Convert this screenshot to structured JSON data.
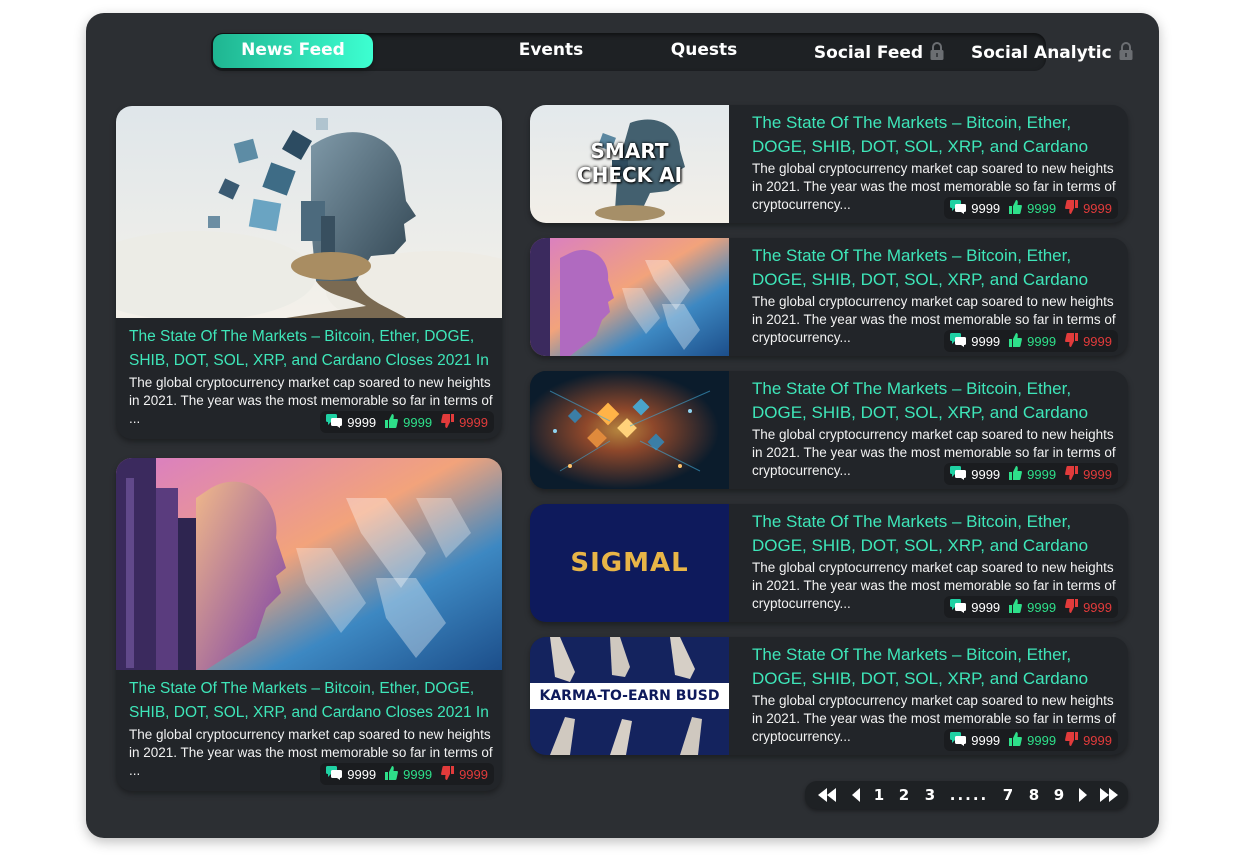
{
  "tabs": [
    {
      "label": "News Feed",
      "active": true,
      "locked": false
    },
    {
      "label": "Events",
      "active": false,
      "locked": false
    },
    {
      "label": "Quests",
      "active": false,
      "locked": false
    },
    {
      "label": "Social Feed",
      "active": false,
      "locked": true
    },
    {
      "label": "Social Analytic",
      "active": false,
      "locked": true
    }
  ],
  "featured": [
    {
      "title": "The State Of The Markets – Bitcoin, Ether, DOGE, SHIB, DOT, SOL, XRP, and Cardano Closes 2021 In",
      "description": "The global cryptocurrency market cap soared to new heights in 2021. The year was the most memorable so far in terms of ...",
      "comments": "9999",
      "likes": "9999",
      "dislikes": "9999",
      "image": "ai-head-cubes"
    },
    {
      "title": "The State Of The Markets – Bitcoin, Ether, DOGE, SHIB, DOT, SOL, XRP, and Cardano Closes 2021 In",
      "description": "The global cryptocurrency market cap soared to new heights in 2021. The year was the most memorable so far in terms of ...",
      "comments": "9999",
      "likes": "9999",
      "dislikes": "9999",
      "image": "ai-face-city-logo"
    }
  ],
  "news": [
    {
      "title": "The State Of The Markets – Bitcoin, Ether, DOGE, SHIB, DOT, SOL, XRP, and Cardano",
      "description": "The global cryptocurrency market cap soared to new heights in 2021. The year was the most memorable so far in terms of cryptocurrency...",
      "comments": "9999",
      "likes": "9999",
      "dislikes": "9999",
      "image": "smart-check-ai",
      "image_text": "SMART CHECK AI"
    },
    {
      "title": "The State Of The Markets – Bitcoin, Ether, DOGE, SHIB, DOT, SOL, XRP, and Cardano",
      "description": "The global cryptocurrency market cap soared to new heights in 2021. The year was the most memorable so far in terms of cryptocurrency...",
      "comments": "9999",
      "likes": "9999",
      "dislikes": "9999",
      "image": "ai-face-city-logo",
      "image_text": ""
    },
    {
      "title": "The State Of The Markets – Bitcoin, Ether, DOGE, SHIB, DOT, SOL, XRP, and Cardano",
      "description": "The global cryptocurrency market cap soared to new heights in 2021. The year was the most memorable so far in terms of cryptocurrency...",
      "comments": "9999",
      "likes": "9999",
      "dislikes": "9999",
      "image": "blockchain-network",
      "image_text": ""
    },
    {
      "title": "The State Of The Markets – Bitcoin, Ether, DOGE, SHIB, DOT, SOL, XRP, and Cardano",
      "description": "The global cryptocurrency market cap soared to new heights in 2021. The year was the most memorable so far in terms of cryptocurrency...",
      "comments": "9999",
      "likes": "9999",
      "dislikes": "9999",
      "image": "sigmal-logo",
      "image_text": "SIGMAL"
    },
    {
      "title": "The State Of The Markets – Bitcoin, Ether, DOGE, SHIB, DOT, SOL, XRP, and Cardano",
      "description": "The global cryptocurrency market cap soared to new heights in 2021. The year was the most memorable so far in terms of cryptocurrency...",
      "comments": "9999",
      "likes": "9999",
      "dislikes": "9999",
      "image": "karma-to-earn",
      "image_text": "KARMA-TO-EARN BUSD"
    }
  ],
  "pagination": {
    "pages_start": [
      "1",
      "2",
      "3"
    ],
    "ellipsis": ".....",
    "pages_end": [
      "7",
      "8",
      "9"
    ]
  },
  "colors": {
    "accent": "#3ee6b9",
    "like": "#2ee08a",
    "dislike": "#e23b3b",
    "panel": "#2c2f33",
    "card": "#222529"
  },
  "icons": [
    "lock-icon",
    "comment-icon",
    "thumbs-up-icon",
    "thumbs-down-icon",
    "first-page-icon",
    "prev-page-icon",
    "next-page-icon",
    "last-page-icon"
  ]
}
